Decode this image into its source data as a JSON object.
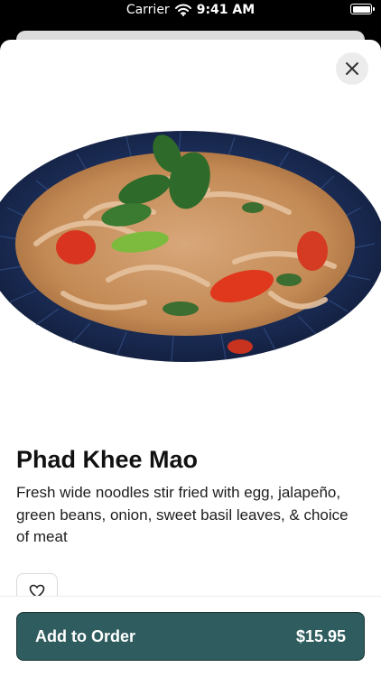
{
  "status_bar": {
    "carrier": "Carrier",
    "time": "9:41 AM",
    "wifi_icon": "wifi-icon",
    "battery_icon": "battery-icon"
  },
  "sheet": {
    "close_icon": "close-icon",
    "dish": {
      "name": "Phad Khee Mao",
      "description": "Fresh wide noodles stir fried with egg, jalapeño, green beans, onion, sweet basil leaves, & choice of meat"
    },
    "favorite_icon": "heart-icon"
  },
  "footer": {
    "add_label": "Add to Order",
    "price": "$15.95"
  },
  "colors": {
    "primary_button": "#2f5c5e",
    "plate": "#1c2f5a",
    "sheet_background": "#ffffff"
  }
}
